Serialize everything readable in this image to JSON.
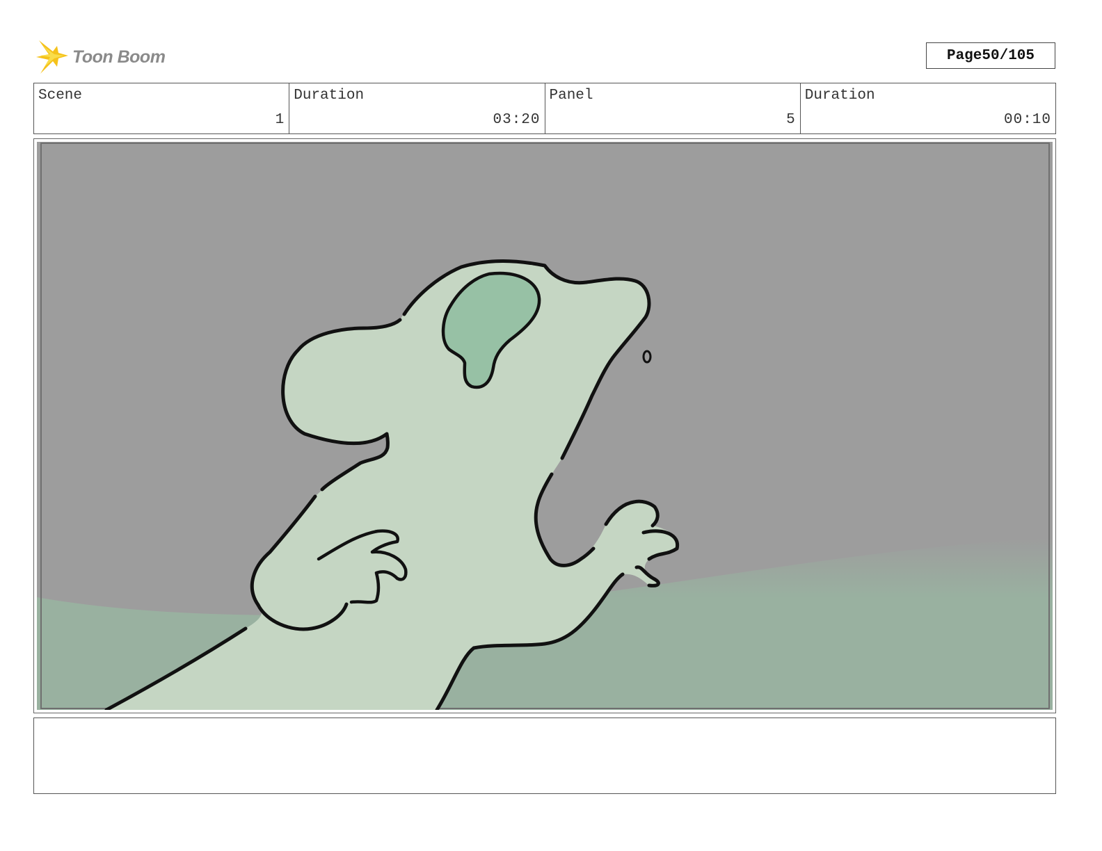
{
  "header": {
    "brand": "Toon Boom",
    "page_label": "Page",
    "page_value": "50/105"
  },
  "info": {
    "scene_label": "Scene",
    "scene_value": "1",
    "scene_duration_label": "Duration",
    "scene_duration_value": "03:20",
    "panel_label": "Panel",
    "panel_value": "5",
    "panel_duration_label": "Duration",
    "panel_duration_value": "00:10"
  },
  "panel": {
    "icon": "storyboard-panel-drawing",
    "colors": {
      "sky": "#9d9d9d",
      "ground": "#99b1a0",
      "character": "#c5d6c3",
      "ear": "#97c1a5",
      "outline": "#111111"
    }
  },
  "notes": {
    "text": ""
  }
}
